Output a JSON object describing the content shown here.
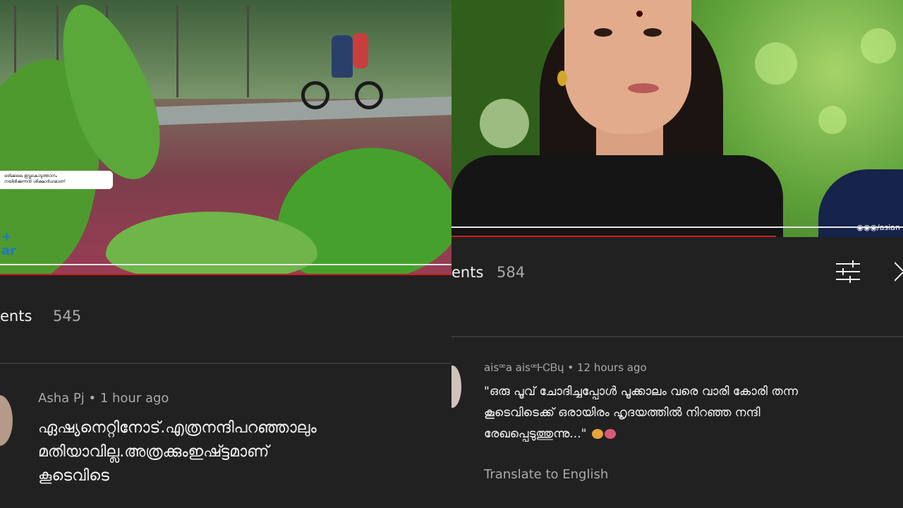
{
  "left_panel": {
    "video": {
      "caption_lines": [
        "ഒരിക്കലെ ഇട്ടുകൊടുത്താനം",
        "നയിരിക്കുന്നത് ശിക്ഷാർഹമാണ്"
      ],
      "logo_text": "+\nar",
      "progress_fraction": 1.0
    },
    "comments_label": "ents",
    "comments_count": "545",
    "comment": {
      "author": "Asha Pj",
      "separator": "•",
      "time": "1 hour ago",
      "lines": [
        "ഏഷ്യനെറ്റിനോട്.എത്രനന്ദിപറഞ്ഞാലും",
        "മതിയാവില്ല.അത്രക്കുംഇഷ്ട്ടമാണ്",
        "കൂടെവിടെ"
      ]
    }
  },
  "right_panel": {
    "video": {
      "watermark": "◉◉◉/asian",
      "progress_fraction": 0.72
    },
    "comments_label": "ents",
    "comments_count": "584",
    "sort_icon": "sort-icon",
    "comment": {
      "author": "aisꟹa aisꟹᎰᏟᏴɥ",
      "separator": "•",
      "time": "12 hours ago",
      "lines": [
        "\"ഒരു പൂവ് ചോദിച്ചപ്പോൾ പൂക്കാലം വരെ വാരി കോരി തന്ന",
        "കൂടെവിടെക്ക് ഒരായിരം ഹൃദയത്തിൽ നിറഞ്ഞ നന്ദി",
        "രേഖപ്പെടുത്തുന്നു...\""
      ],
      "translate_label": "Translate to English"
    }
  },
  "colors": {
    "background": "#212121",
    "progress": "#cc1f1f",
    "text_primary": "#f1f1f1",
    "text_secondary": "#aaaaaa"
  }
}
